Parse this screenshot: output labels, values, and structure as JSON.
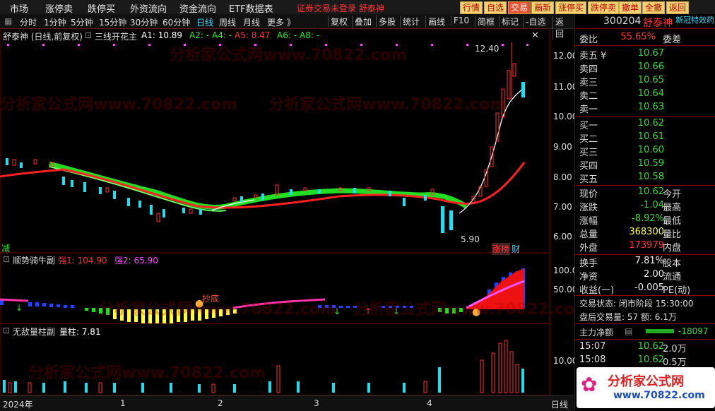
{
  "menu": [
    "市场",
    "涨停卖",
    "跌停买",
    "外资流向",
    "资金流向",
    "ETF数据表"
  ],
  "menu_red": "证券交易未登录  舒泰神",
  "right_buttons": [
    "行情",
    "自选",
    "交易",
    "画新",
    "涨停买",
    "跌停卖",
    "撤单",
    "全撤",
    "返回"
  ],
  "periods": [
    "分时",
    "1分钟",
    "5分钟",
    "15分钟",
    "30分钟",
    "60分钟",
    "日线",
    "周线",
    "月线",
    "更多 》"
  ],
  "tools": [
    "复权",
    "叠加",
    "多股",
    "统计",
    "画线",
    "F10",
    "简框",
    "标记",
    "-自选",
    "返回"
  ],
  "main_indicator": {
    "title": "舒泰神 (日线,前复权)",
    "name": "三线开花主",
    "a1": "A1: 10.89",
    "a2": "A2: -",
    "a4": "A4: -",
    "a5": "A5: 8.47",
    "a6": "A6: -",
    "a8": "A8: -"
  },
  "price_axis": [
    "12.00",
    "11.00",
    "10.00",
    "9.00",
    "8.00",
    "7.00",
    "6.00"
  ],
  "annotations": {
    "high": "12.40",
    "low": "5.90",
    "tag1": "涨榜",
    "tag2": "财",
    "left_tag": "减"
  },
  "sub1": {
    "name": "顺势骑牛副",
    "v1": "强1: 104.90",
    "v2": "强2: 65.90",
    "axis": [
      "100.0",
      "50.00"
    ],
    "tag": "抄底"
  },
  "sub2": {
    "name": "无敌量柱副",
    "v1": "量柱: 7.81",
    "axis": [
      "10.00"
    ]
  },
  "date_axis": [
    "2024年",
    "1",
    "2",
    "3",
    "4",
    "日线"
  ],
  "quote": {
    "code": "300204",
    "name": "舒泰神",
    "banner": "新冠特效药",
    "weibi_label": "委比",
    "weibi": "55.65%",
    "weicha_label": "委差",
    "asks": [
      [
        "卖五 ¥",
        "10.67"
      ],
      [
        "卖四",
        "10.66"
      ],
      [
        "卖三",
        "10.65"
      ],
      [
        "卖二",
        "10.64"
      ],
      [
        "卖一",
        "10.63"
      ]
    ],
    "bids": [
      [
        "买一",
        "10.62"
      ],
      [
        "买二",
        "10.61"
      ],
      [
        "买三",
        "10.60"
      ],
      [
        "买四",
        "10.59"
      ],
      [
        "买五",
        "10.58"
      ]
    ],
    "stats": [
      [
        "现价",
        "10.62",
        "今开",
        ""
      ],
      [
        "涨跌",
        "-1.04",
        "最高",
        ""
      ],
      [
        "涨幅",
        "-8.92%",
        "最低",
        ""
      ],
      [
        "总量",
        "368300",
        "量比",
        ""
      ],
      [
        "外盘",
        "173979",
        "内盘",
        ""
      ]
    ],
    "stats2": [
      [
        "换手",
        "7.81%",
        "股本"
      ],
      [
        "净资",
        "2.00",
        "流通"
      ],
      [
        "收益(一)",
        "-0.005",
        "PE(动)"
      ]
    ],
    "trade_status": "交易状态: 闭市阶段 15:30:00",
    "after_hours": "盘后交易量: 57  额: 6.1万",
    "main_flow_label": "主力净额",
    "main_flow": "-18097",
    "ticks": [
      [
        "15:07",
        "10.62",
        "2.0万"
      ],
      [
        "15:08",
        "10.62",
        "0.5万"
      ]
    ],
    "logo_text": "分析家公式网",
    "logo_url": "www.70822.com"
  },
  "watermark": "分析家公式网www.70822.com"
}
